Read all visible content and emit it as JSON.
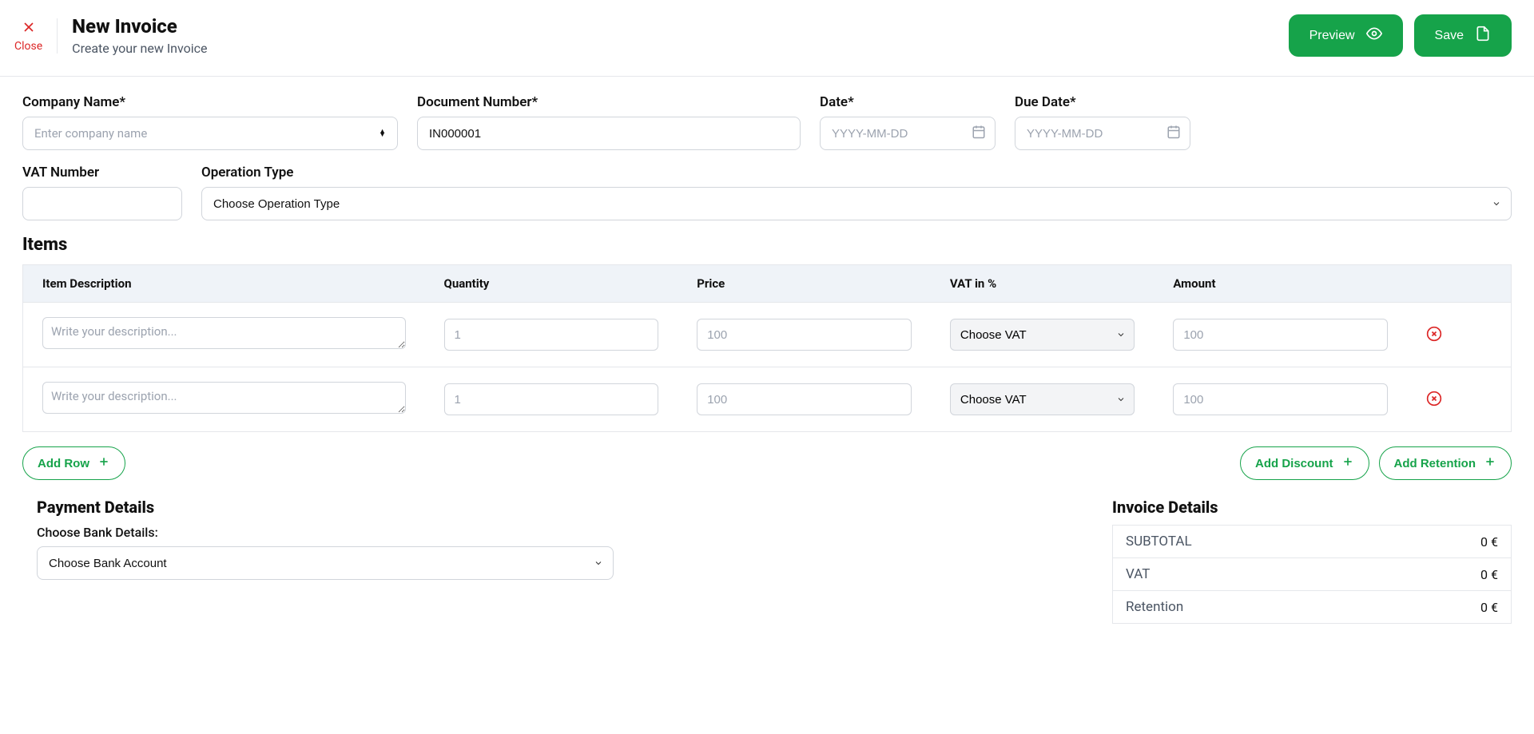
{
  "header": {
    "close_label": "Close",
    "title": "New Invoice",
    "subtitle": "Create your new Invoice",
    "preview_label": "Preview",
    "save_label": "Save"
  },
  "form": {
    "company": {
      "label": "Company Name*",
      "placeholder": "Enter company name",
      "value": ""
    },
    "doc_number": {
      "label": "Document Number*",
      "value": "IN000001"
    },
    "date": {
      "label": "Date*",
      "placeholder": "YYYY-MM-DD",
      "value": ""
    },
    "due_date": {
      "label": "Due Date*",
      "placeholder": "YYYY-MM-DD",
      "value": ""
    },
    "vat_number": {
      "label": "VAT Number",
      "value": ""
    },
    "operation_type": {
      "label": "Operation Type",
      "placeholder": "Choose Operation Type"
    }
  },
  "items_section": {
    "title": "Items",
    "headers": {
      "description": "Item Description",
      "quantity": "Quantity",
      "price": "Price",
      "vat": "VAT in %",
      "amount": "Amount"
    },
    "row_placeholders": {
      "description": "Write your description...",
      "quantity": "1",
      "price": "100",
      "vat": "Choose VAT",
      "amount": "100"
    },
    "rows": [
      {
        "description": "",
        "quantity": "",
        "price": "",
        "vat": "",
        "amount": ""
      },
      {
        "description": "",
        "quantity": "",
        "price": "",
        "vat": "",
        "amount": ""
      }
    ]
  },
  "buttons": {
    "add_row": "Add Row",
    "add_discount": "Add Discount",
    "add_retention": "Add Retention"
  },
  "payment": {
    "title": "Payment Details",
    "choose_bank_label": "Choose Bank Details:",
    "bank_placeholder": "Choose Bank Account"
  },
  "invoice_details": {
    "title": "Invoice Details",
    "rows": [
      {
        "label": "SUBTOTAL",
        "value": "0 €"
      },
      {
        "label": "VAT",
        "value": "0 €"
      },
      {
        "label": "Retention",
        "value": "0 €"
      }
    ]
  }
}
